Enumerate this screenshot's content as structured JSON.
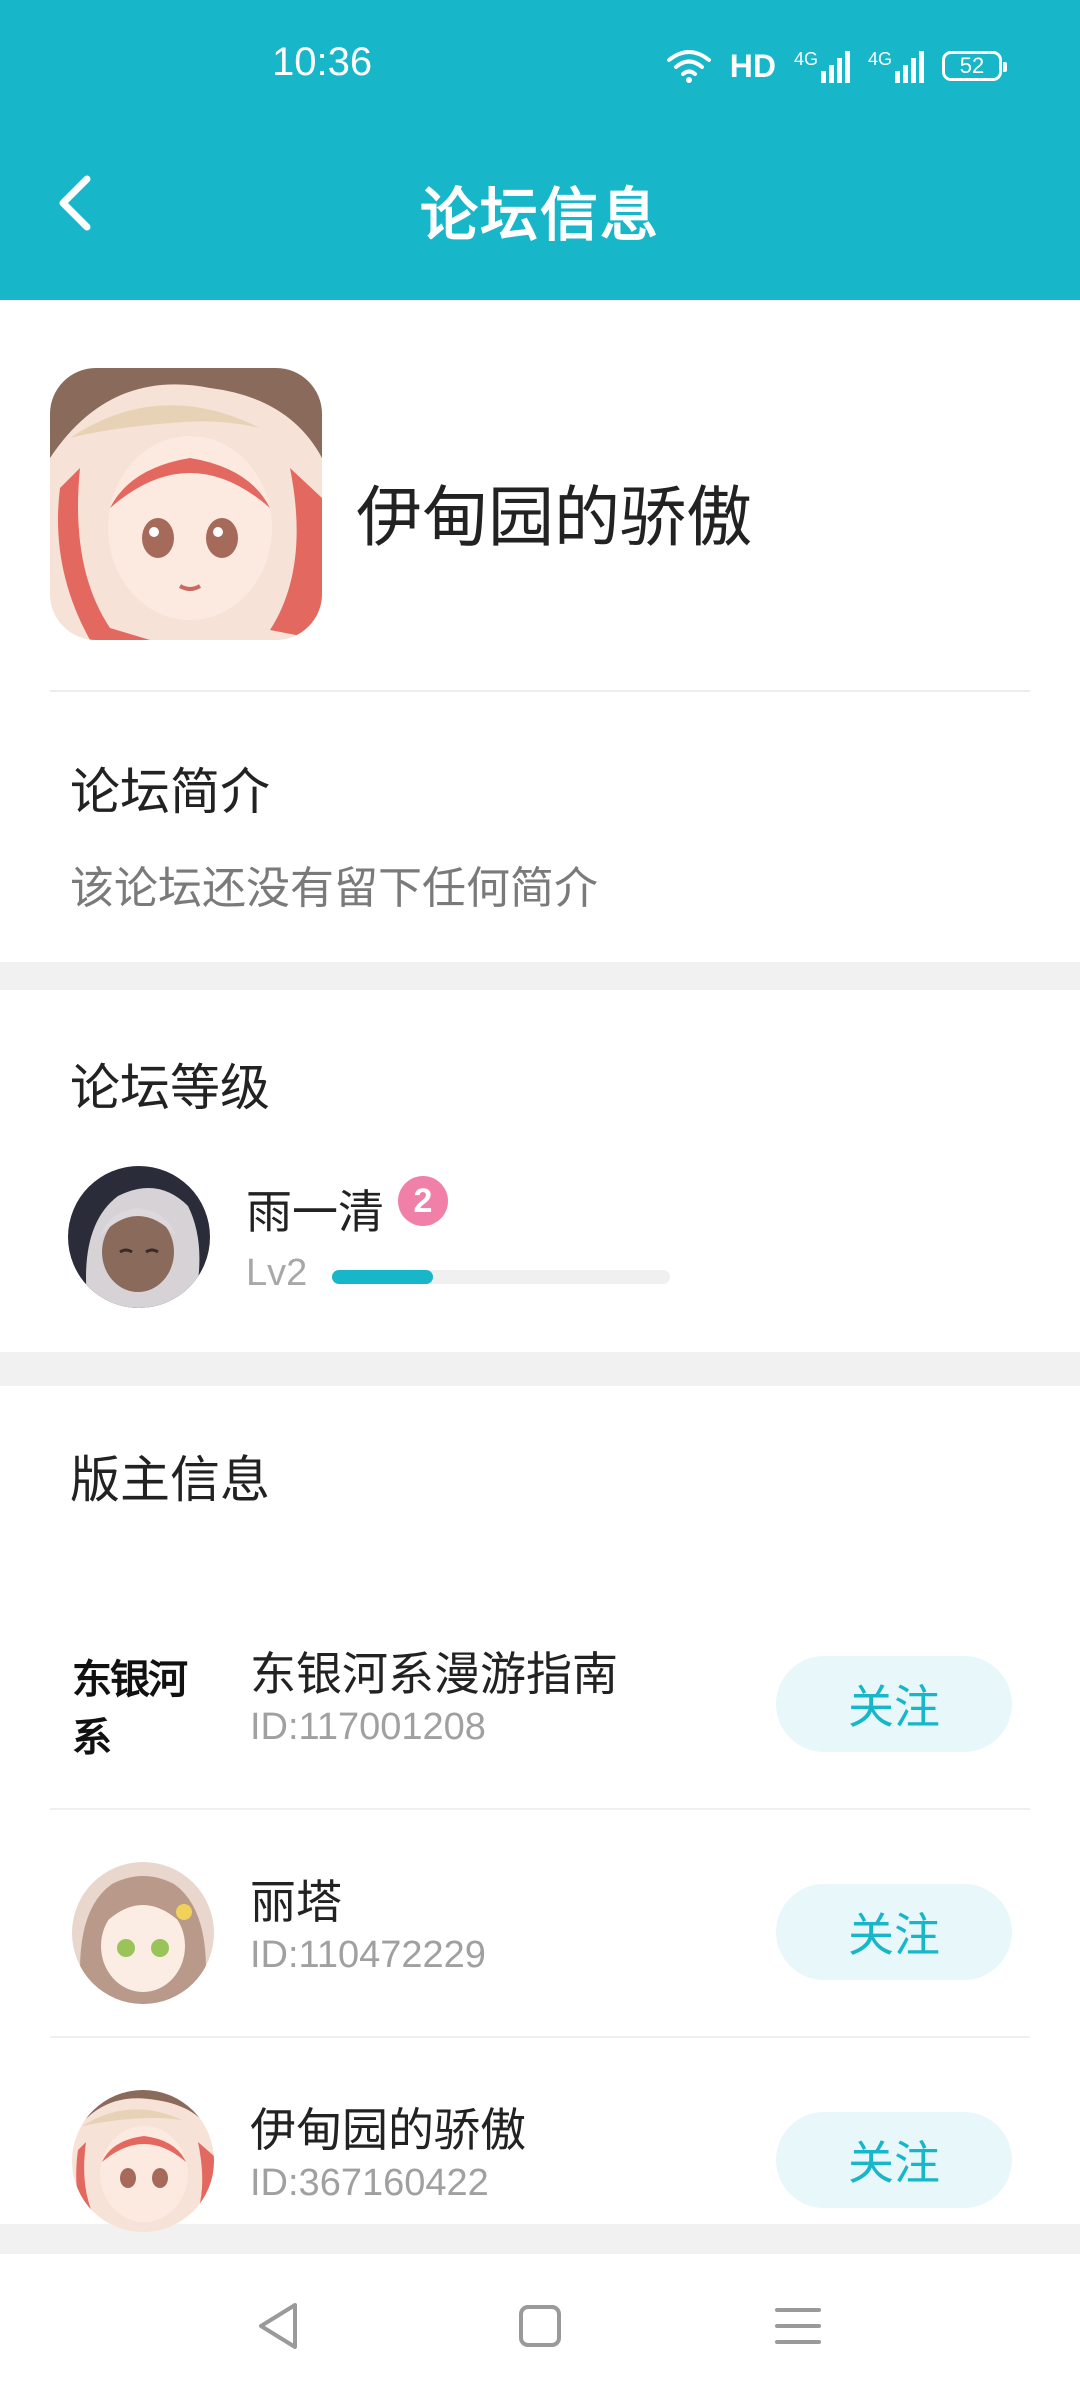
{
  "status_bar": {
    "time": "10:36",
    "network_label": "HD",
    "signal_1": "4G",
    "signal_2": "4G",
    "battery_level": "52"
  },
  "header": {
    "title": "论坛信息",
    "back_icon": "chevron-left-icon"
  },
  "forum": {
    "name": "伊甸园的骄傲",
    "intro_title": "论坛简介",
    "intro_text": "该论坛还没有留下任何简介"
  },
  "level_section": {
    "title": "论坛等级",
    "member_name": "雨一清",
    "badge": "2",
    "level_label": "Lv2",
    "progress": 0.3
  },
  "moderators": {
    "title": "版主信息",
    "items": [
      {
        "logo_text": "东银河系",
        "name": "东银河系漫游指南",
        "id": "ID:117001208",
        "follow_label": "关注"
      },
      {
        "name": "丽塔",
        "id": "ID:110472229",
        "follow_label": "关注"
      },
      {
        "name": "伊甸园的骄傲",
        "id": "ID:367160422",
        "follow_label": "关注"
      }
    ]
  },
  "navbar": {
    "back": "triangle-back-icon",
    "home": "square-home-icon",
    "menu": "menu-lines-icon"
  },
  "colors": {
    "accent": "#17b6c8",
    "follow_bg": "#e8f8fa",
    "badge_pink": "#f080a8"
  }
}
